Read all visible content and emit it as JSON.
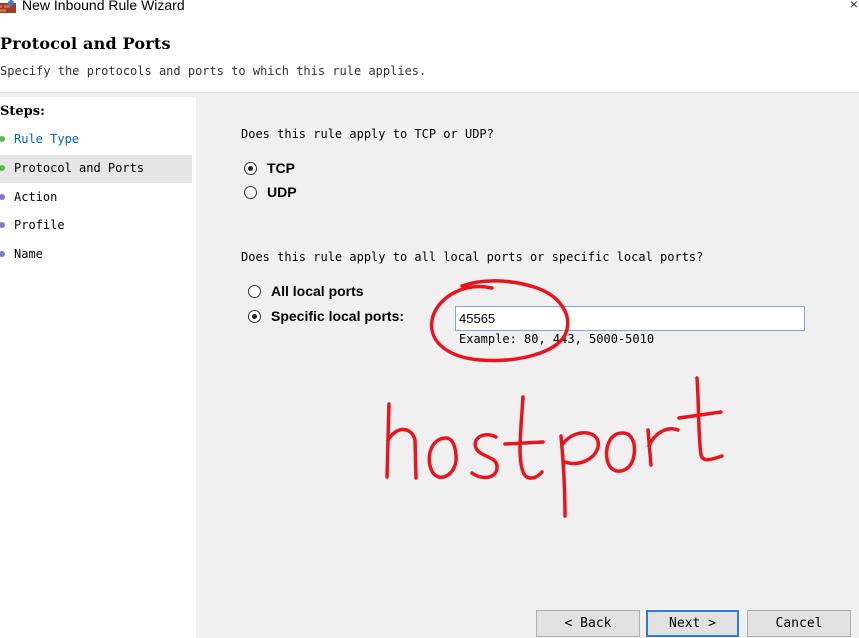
{
  "window": {
    "title": "New Inbound Rule Wizard",
    "close_glyph": "×"
  },
  "header": {
    "title": "Protocol and Ports",
    "subtitle": "Specify the protocols and ports to which this rule applies."
  },
  "steps": {
    "title": "Steps:",
    "items": [
      {
        "label": "Rule Type",
        "color": "#0066cc",
        "dot": "#5db84b"
      },
      {
        "label": "Protocol and Ports",
        "color": "#000000",
        "dot": "#5db84b",
        "active": true
      },
      {
        "label": "Action",
        "color": "#000000",
        "dot": "#7b7bd6"
      },
      {
        "label": "Profile",
        "color": "#000000",
        "dot": "#7b7bd6"
      },
      {
        "label": "Name",
        "color": "#000000",
        "dot": "#7b7bd6"
      }
    ]
  },
  "protocol": {
    "question": "Does this rule apply to TCP or UDP?",
    "options": [
      {
        "label": "TCP",
        "checked": true
      },
      {
        "label": "UDP",
        "checked": false
      }
    ]
  },
  "ports": {
    "question": "Does this rule apply to all local ports or specific local ports?",
    "options": [
      {
        "label": "All local ports",
        "checked": false
      },
      {
        "label": "Specific local ports:",
        "checked": true
      }
    ],
    "value": "45565",
    "example": "Example: 80, 443, 5000-5010"
  },
  "buttons": {
    "back": "< Back",
    "next": "Next >",
    "cancel": "Cancel"
  },
  "annotation": {
    "handwritten_text": "hostport",
    "ink_color": "#e8141e"
  }
}
